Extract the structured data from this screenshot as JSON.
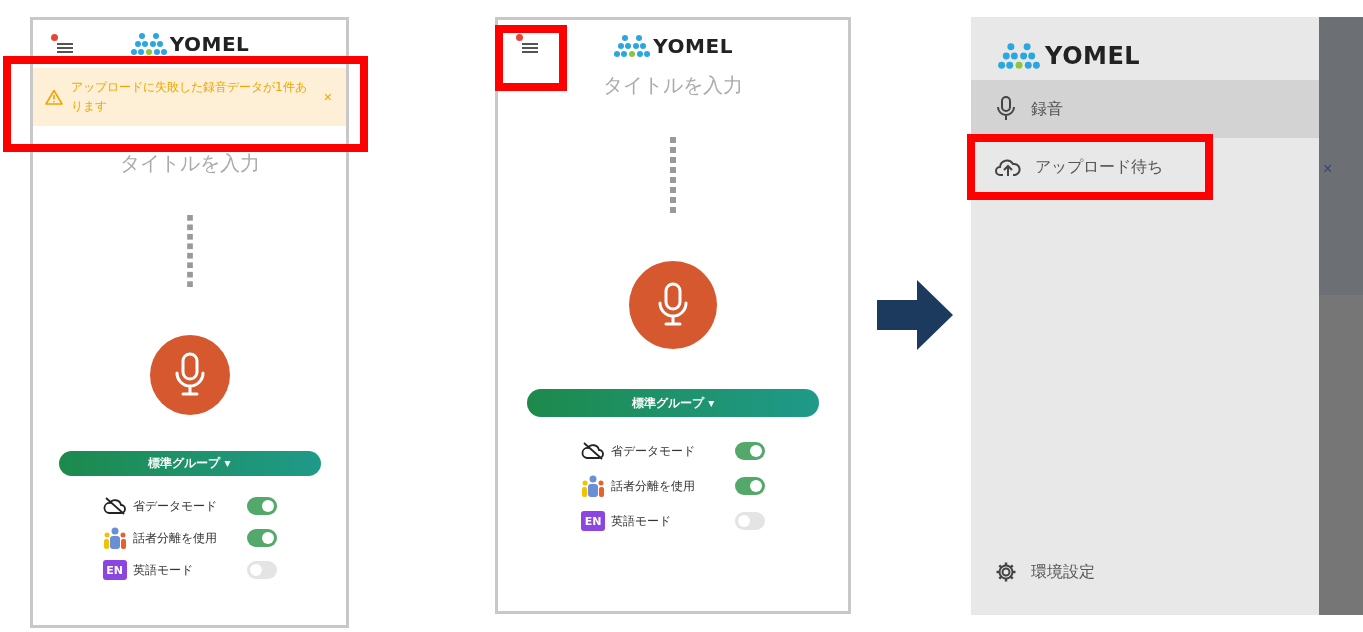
{
  "screens": [
    {
      "kind": "recorder",
      "menu": {
        "badge": true,
        "highlighted": false
      },
      "logo": "YOMEL",
      "alert": {
        "text": "アップロードに失敗した録音データが1件あります",
        "close": "×",
        "highlighted": true
      },
      "title_placeholder": "タイトルを入力",
      "group_button": "標準グループ ▾",
      "toggles": [
        {
          "kind": "data-saver",
          "label": "省データモード",
          "on": true
        },
        {
          "kind": "speakers",
          "label": "話者分離を使用",
          "on": true
        },
        {
          "kind": "english",
          "label": "英語モード",
          "icon_text": "EN",
          "on": false
        }
      ]
    },
    {
      "kind": "recorder",
      "menu": {
        "badge": true,
        "highlighted": true
      },
      "logo": "YOMEL",
      "title_placeholder": "タイトルを入力",
      "group_button": "標準グループ ▾",
      "toggles": [
        {
          "kind": "data-saver",
          "label": "省データモード",
          "on": true
        },
        {
          "kind": "speakers",
          "label": "話者分離を使用",
          "on": true
        },
        {
          "kind": "english",
          "label": "英語モード",
          "icon_text": "EN",
          "on": false
        }
      ]
    },
    {
      "kind": "drawer",
      "logo": "YOMEL",
      "items": [
        {
          "kind": "mic",
          "label": "録音",
          "selected": true,
          "highlighted": false
        },
        {
          "kind": "upload",
          "label": "アップロード待ち",
          "selected": false,
          "highlighted": true
        }
      ],
      "settings": "環境設定",
      "close": "×"
    }
  ]
}
